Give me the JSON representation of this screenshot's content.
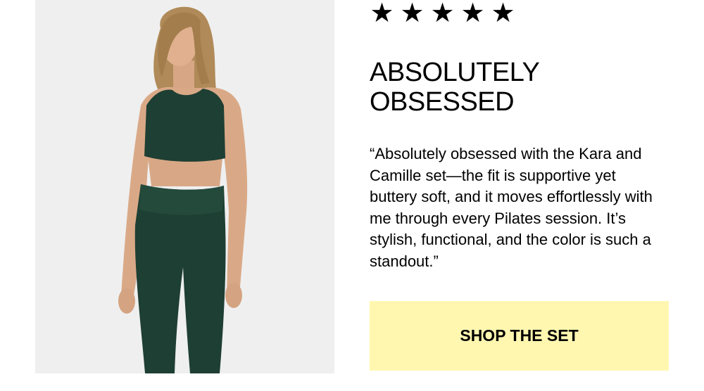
{
  "rating": {
    "stars": 5,
    "star_glyph": "★",
    "star_color": "#000000"
  },
  "headline": {
    "line1": "ABSOLUTELY",
    "line2": "OBSESSED"
  },
  "quote": "“Absolutely obsessed with the Kara and Camille set—the fit is supportive yet buttery soft, and it moves effortlessly with me through every Pilates session. It’s stylish, functional, and the color is such a standout.”",
  "cta": {
    "label": "SHOP THE SET",
    "background": "#fff7b0"
  },
  "product_image": {
    "icon": "model-photo",
    "outfit_color": "#1e3f33",
    "background": "#efefef"
  }
}
